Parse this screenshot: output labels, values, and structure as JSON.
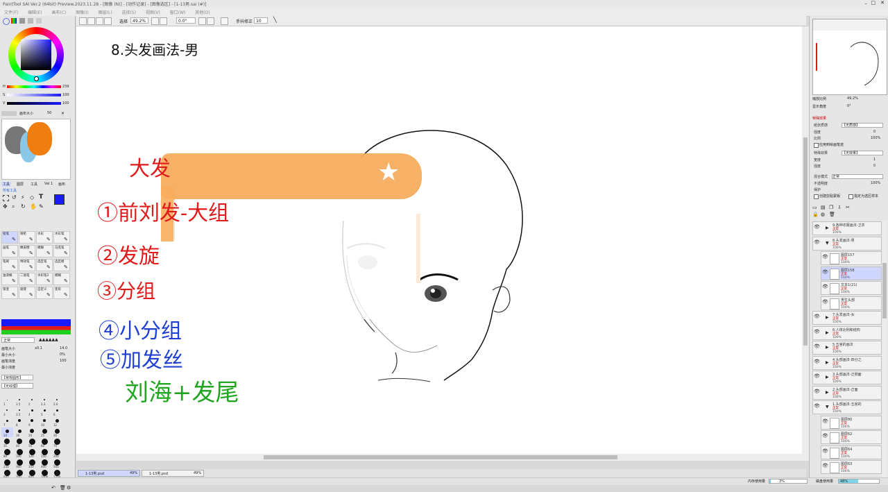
{
  "titlebar": {
    "text": "PaintTool SAI Ver.2 (64bit) Preview.2023.11.28 - [图像 (N)] - [动作记录] - [图像选区] - [1-13男.sai (#)]"
  },
  "menu": [
    "文件(F)",
    "编辑(E)",
    "画布(C)",
    "图像(I)",
    "图层(L)",
    "选择(S)",
    "视图(V)",
    "窗口(W)",
    "其他(O)"
  ],
  "toolbar": {
    "selection_label": "选择",
    "zoom": "49.2%",
    "rotation": "0.0°",
    "stabilizer_label": "手抖修正",
    "stabilizer_value": "10"
  },
  "colors": {
    "accent": "#5b6bd8",
    "selected_layer": "#cfd6ff",
    "orange_overlay": "#f7ad5e",
    "red_ink": "#e01a1a",
    "blue_ink": "#1f3fd0",
    "green_ink": "#22a622",
    "primary_color": "#1a1aff"
  },
  "color_panel": {
    "sliders": [
      {
        "label": "H",
        "value": "239"
      },
      {
        "label": "S",
        "value": "100"
      },
      {
        "label": "V",
        "value": "100"
      }
    ],
    "mixer_label": "画布大小",
    "mixer_value": "50"
  },
  "tool_tabs": [
    "工具",
    "图层",
    "工具",
    "Val 1",
    "画布"
  ],
  "tools_heading": "所有工具",
  "brush_tools": [
    [
      "铅笔",
      "喷枪",
      "水彩",
      "水彩笔"
    ],
    [
      "画笔",
      "橡皮擦",
      "模糊",
      "马克笔"
    ],
    [
      "笔刷",
      "特效笔",
      "选区笔",
      "选区擦"
    ],
    [
      "油漆桶",
      "二值笔",
      "水彩笔2",
      "模糊"
    ],
    [
      "渐变",
      "吸管",
      "自定义",
      "变形"
    ]
  ],
  "brush_settings": {
    "mode": "正常",
    "rows": [
      {
        "label": "画笔大小",
        "prefix": "x0.1",
        "value": "14.0"
      },
      {
        "label": "最小大小",
        "prefix": "",
        "value": "0%"
      },
      {
        "label": "画笔浓度",
        "prefix": "",
        "value": "100"
      },
      {
        "label": "最小浓度",
        "prefix": "",
        "value": ""
      }
    ],
    "shape_select": "【常规圆形】",
    "texture_select": "【无纹理】"
  },
  "brush_sizes": [
    "1",
    "1.5",
    "2",
    "2.3",
    "2.6",
    "3",
    "3.5",
    "4",
    "5",
    "6",
    "7",
    "8",
    "9",
    "10",
    "12",
    "14",
    "16",
    "20",
    "25",
    "30",
    "35",
    "40",
    "50",
    "60",
    "70",
    "80",
    "100",
    "120",
    "150",
    "200",
    "250",
    "300",
    "350",
    "400",
    "500",
    "600",
    "700",
    "800",
    "1000",
    "1200"
  ],
  "canvas_text": {
    "heading": "8.头发画法-男",
    "notes": [
      {
        "text": "大发",
        "color": "red"
      },
      {
        "text": "①前刘发-大组",
        "color": "red"
      },
      {
        "text": "②发旋",
        "color": "red"
      },
      {
        "text": "③分组",
        "color": "red"
      },
      {
        "text": "④小分组",
        "color": "blue"
      },
      {
        "text": "⑤加发丝",
        "color": "blue"
      },
      {
        "text": "刘海+发尾",
        "color": "green"
      }
    ]
  },
  "navigator": {
    "zoom_label": "缩放比例",
    "zoom_value": "49.2%",
    "angle_label": "显示角度",
    "angle_value": "0°"
  },
  "layer_props": {
    "section_title": "特殊效果",
    "rows": [
      {
        "label": "纸张质感",
        "value": "【无质感】"
      },
      {
        "label": "强度",
        "value": "0"
      },
      {
        "label": "比例",
        "value": "100%"
      },
      {
        "label": "应用到绘画笔迹",
        "value": ""
      },
      {
        "label": "特殊效果",
        "value": "【无效果】"
      },
      {
        "label": "宽度",
        "value": "1"
      },
      {
        "label": "强度",
        "value": "0"
      }
    ],
    "blend_label": "混合模式",
    "blend_value": "正常",
    "opacity_label": "不透明度",
    "opacity_value": "100%",
    "protect_label": "保护",
    "clip_label": "创建剪贴蒙版",
    "select_src_label": "指定为选区样本"
  },
  "layers": [
    {
      "name": "9.各种衣服画法-卫衣",
      "mode": "正常",
      "pct": "100%",
      "sub": false,
      "selected": false
    },
    {
      "name": "8.头发画法-男",
      "mode": "正常",
      "pct": "100%",
      "sub": false,
      "selected": false
    },
    {
      "name": "图层157",
      "mode": "正常",
      "pct": "100%",
      "sub": true,
      "selected": false
    },
    {
      "name": "图层158",
      "mode": "正常",
      "pct": "100%",
      "sub": true,
      "selected": true
    },
    {
      "name": "文本1(21)",
      "mode": "正常",
      "pct": "100%",
      "sub": true,
      "selected": false
    },
    {
      "name": "男生头部",
      "mode": "正常",
      "pct": "100%",
      "sub": true,
      "selected": false
    },
    {
      "name": "7.头发画法-女",
      "mode": "正常",
      "pct": "100%",
      "sub": false,
      "selected": false
    },
    {
      "name": "6.人体比例和结构",
      "mode": "正常",
      "pct": "100%",
      "sub": false,
      "selected": false
    },
    {
      "name": "5.五官的画法",
      "mode": "正常",
      "pct": "100%",
      "sub": false,
      "selected": false
    },
    {
      "name": "4.头部画法-四分之",
      "mode": "正常",
      "pct": "100%",
      "sub": false,
      "selected": false
    },
    {
      "name": "3.头部画法-正侧面",
      "mode": "正常",
      "pct": "100%",
      "sub": false,
      "selected": false
    },
    {
      "name": "2.头部画法-正面",
      "mode": "正常",
      "pct": "100%",
      "sub": false,
      "selected": false
    },
    {
      "name": "1.头部画法-五官的",
      "mode": "正常",
      "pct": "100%",
      "sub": false,
      "selected": false
    },
    {
      "name": "图层80",
      "mode": "正常",
      "pct": "100%",
      "sub": true,
      "selected": false
    },
    {
      "name": "图层62",
      "mode": "正常",
      "pct": "100%",
      "sub": true,
      "selected": false
    },
    {
      "name": "图层64",
      "mode": "正常",
      "pct": "100%",
      "sub": true,
      "selected": false
    },
    {
      "name": "图层63",
      "mode": "正常",
      "pct": "100%",
      "sub": true,
      "selected": false
    }
  ],
  "doc_tabs": [
    {
      "name": "1-13男.psd",
      "zoom": "49%"
    },
    {
      "name": "1-13男.psd",
      "zoom": "49%"
    }
  ],
  "status": {
    "memory_label": "内存使用量",
    "memory_value": "3%",
    "disk_label": "磁盘使用量",
    "disk_value": "48%"
  }
}
